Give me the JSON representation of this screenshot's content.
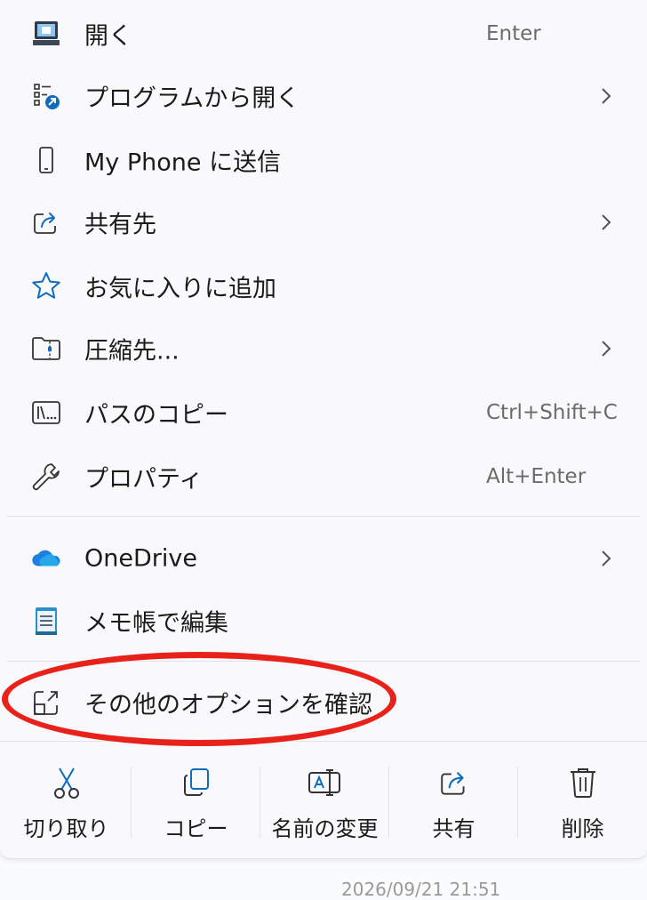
{
  "menu": {
    "items": [
      {
        "label": "開く",
        "shortcut": "Enter",
        "icon": "computer-icon"
      },
      {
        "label": "プログラムから開く",
        "icon": "open-with-icon",
        "submenu": true
      },
      {
        "label": "My Phone に送信",
        "icon": "phone-icon"
      },
      {
        "label": "共有先",
        "icon": "share-icon",
        "submenu": true
      },
      {
        "label": "お気に入りに追加",
        "icon": "star-icon"
      },
      {
        "label": "圧縮先...",
        "icon": "zip-folder-icon",
        "submenu": true
      },
      {
        "label": "パスのコピー",
        "shortcut": "Ctrl+Shift+C",
        "icon": "copy-path-icon"
      },
      {
        "label": "プロパティ",
        "shortcut": "Alt+Enter",
        "icon": "wrench-icon"
      },
      {
        "label": "OneDrive",
        "icon": "onedrive-icon",
        "submenu": true
      },
      {
        "label": "メモ帳で編集",
        "icon": "notepad-icon"
      },
      {
        "label": "その他のオプションを確認",
        "icon": "more-options-icon"
      }
    ],
    "quick_actions": [
      {
        "label": "切り取り",
        "icon": "scissors-icon"
      },
      {
        "label": "コピー",
        "icon": "copy-icon"
      },
      {
        "label": "名前の変更",
        "icon": "rename-icon"
      },
      {
        "label": "共有",
        "icon": "share-icon"
      },
      {
        "label": "削除",
        "icon": "trash-icon"
      }
    ]
  },
  "footer": {
    "timestamp": "2026/09/21 21:51"
  },
  "colors": {
    "accent": "#0f6cbd",
    "highlight": "#e8221b",
    "onedrive": "#1d7fe0"
  }
}
